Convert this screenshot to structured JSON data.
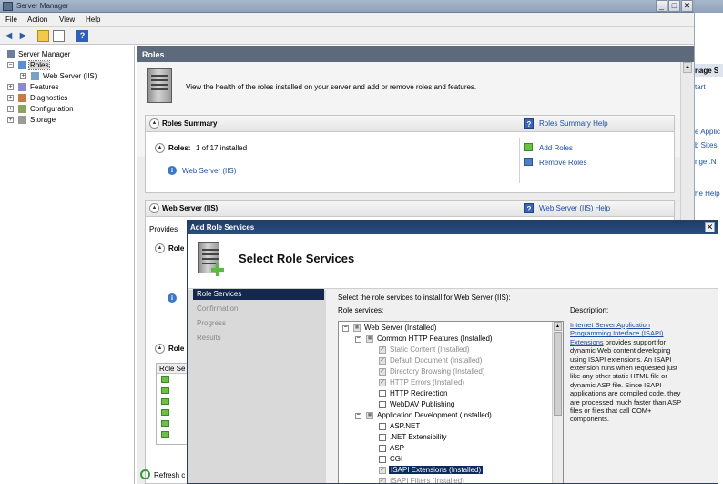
{
  "window": {
    "title": "Server Manager"
  },
  "menu": [
    "File",
    "Action",
    "View",
    "Help"
  ],
  "tree": {
    "root": "Server Manager",
    "roles": "Roles",
    "web_server": "Web Server (IIS)",
    "features": "Features",
    "diagnostics": "Diagnostics",
    "configuration": "Configuration",
    "storage": "Storage"
  },
  "roles_pane": {
    "header": "Roles",
    "intro": "View the health of the roles installed on your server and add or remove roles and features.",
    "summary_title": "Roles Summary",
    "summary_help": "Roles Summary Help",
    "roles_label": "Roles:",
    "roles_count": "1 of 17 installed",
    "web_server_link": "Web Server (IIS)",
    "add_roles": "Add Roles",
    "remove_roles": "Remove Roles",
    "web_title": "Web Server (IIS)",
    "web_help": "Web Server (IIS) Help",
    "provides_text": "Provides",
    "role_partial_1": "Role",
    "role_partial_2": "Role",
    "role_services_col": "Role Se",
    "refresh": "Refresh c"
  },
  "actions": [
    "nage S",
    "tart",
    "e Applic",
    "b Sites",
    "nge .N",
    "he Help"
  ],
  "dialog": {
    "title": "Add Role Services",
    "heading": "Select Role Services",
    "nav": [
      "Role Services",
      "Confirmation",
      "Progress",
      "Results"
    ],
    "instruction": "Select the role services to install for Web Server (IIS):",
    "services_label": "Role services:",
    "description_label": "Description:",
    "description_link": "Internet Server Application Programming Interface (ISAPI) Extensions",
    "description_text": " provides support for dynamic Web content developing using ISAPI extensions. An ISAPI extension runs when requested just like any other static HTML file or dynamic ASP file. Since ISAPI applications are compiled code, they are processed much faster than ASP files or files that call COM+ components.",
    "services": [
      "Web Server  (Installed)",
      "Common HTTP Features  (Installed)",
      "Static Content  (Installed)",
      "Default Document  (Installed)",
      "Directory Browsing  (Installed)",
      "HTTP Errors  (Installed)",
      "HTTP Redirection",
      "WebDAV Publishing",
      "Application Development  (Installed)",
      "ASP.NET",
      ".NET Extensibility",
      "ASP",
      "CGI",
      "ISAPI Extensions  (Installed)",
      "ISAPI Filters  (Installed)"
    ]
  }
}
